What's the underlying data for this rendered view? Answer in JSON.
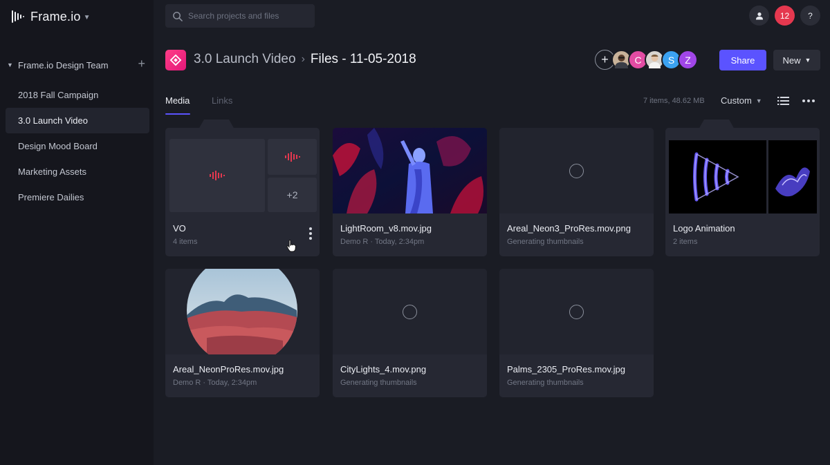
{
  "brand": {
    "name": "Frame.io"
  },
  "sidebar": {
    "team": "Frame.io Design Team",
    "projects": [
      {
        "label": "2018 Fall Campaign"
      },
      {
        "label": "3.0 Launch Video"
      },
      {
        "label": "Design Mood Board"
      },
      {
        "label": "Marketing Assets"
      },
      {
        "label": "Premiere Dailies"
      }
    ],
    "active_index": 1
  },
  "search": {
    "placeholder": "Search projects and files"
  },
  "topbar": {
    "notifications": "12",
    "help": "?"
  },
  "header": {
    "project": "3.0 Launch Video",
    "current": "Files - 11-05-2018",
    "collaborators": [
      {
        "initial": "+",
        "color": "#1a1c24"
      },
      {
        "initial": "",
        "color": "#c9b39a"
      },
      {
        "initial": "C",
        "color": "#e34ca3"
      },
      {
        "initial": "",
        "color": "#d8d4cf"
      },
      {
        "initial": "S",
        "color": "#3ba2f2"
      },
      {
        "initial": "Z",
        "color": "#a146e8"
      }
    ],
    "share": "Share",
    "new": "New"
  },
  "tabs": {
    "media": "Media",
    "links": "Links"
  },
  "toolbar": {
    "meta": "7 items, 48.62 MB",
    "sort": "Custom"
  },
  "cards": [
    {
      "title": "VO",
      "sub": "4 items",
      "type": "folder-audio",
      "extra": "+2"
    },
    {
      "title": "LightRoom_v8.mov.jpg",
      "sub": "Demo R · Today, 2:34pm",
      "type": "image-statue"
    },
    {
      "title": "Areal_Neon3_ProRes.mov.png",
      "sub": "Generating thumbnails",
      "type": "pending"
    },
    {
      "title": "Logo Animation",
      "sub": "2 items",
      "type": "folder-logo"
    },
    {
      "title": "Areal_NeonProRes.mov.jpg",
      "sub": "Demo R · Today, 2:34pm",
      "type": "image-mountain"
    },
    {
      "title": "CityLights_4.mov.png",
      "sub": "Generating thumbnails",
      "type": "pending"
    },
    {
      "title": "Palms_2305_ProRes.mov.jpg",
      "sub": "Generating thumbnails",
      "type": "pending"
    }
  ],
  "colors": {
    "accent": "#5b53ff",
    "notification": "#e5384f",
    "project_icon": "#ff3d87"
  }
}
